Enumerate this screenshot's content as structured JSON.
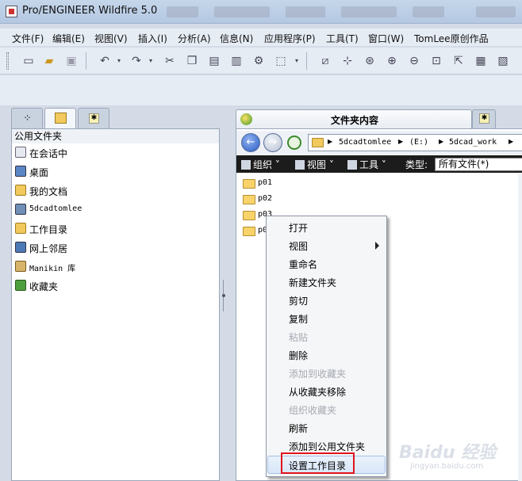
{
  "window": {
    "title": "Pro/ENGINEER Wildfire 5.0"
  },
  "menubar": [
    {
      "label": "文件(F)"
    },
    {
      "label": "编辑(E)"
    },
    {
      "label": "视图(V)"
    },
    {
      "label": "插入(I)"
    },
    {
      "label": "分析(A)"
    },
    {
      "label": "信息(N)"
    },
    {
      "label": "应用程序(P)"
    },
    {
      "label": "工具(T)"
    },
    {
      "label": "窗口(W)"
    },
    {
      "label": "TomLee原创作品"
    }
  ],
  "left_panel": {
    "header": "公用文件夹",
    "items": [
      {
        "label": "在会话中",
        "icon": "session-icon"
      },
      {
        "label": "桌面",
        "icon": "desktop-icon"
      },
      {
        "label": "我的文档",
        "icon": "documents-icon"
      },
      {
        "label": "5dcadtomlee",
        "icon": "computer-icon"
      },
      {
        "label": "工作目录",
        "icon": "working-dir-icon"
      },
      {
        "label": "网上邻居",
        "icon": "network-icon"
      },
      {
        "label": "Manikin 库",
        "icon": "library-icon"
      },
      {
        "label": "收藏夹",
        "icon": "favorites-icon"
      }
    ]
  },
  "right_panel": {
    "tab_title": "文件夹内容",
    "address": [
      "5dcadtomlee",
      "(E:)",
      "5dcad_work"
    ],
    "commands": {
      "organize": "组织",
      "view": "视图",
      "tools": "工具",
      "type_label": "类型:",
      "type_value": "所有文件(*)"
    },
    "folders": [
      "p01",
      "p02",
      "p03",
      "p04"
    ]
  },
  "context_menu": [
    {
      "label": "打开",
      "disabled": false
    },
    {
      "label": "视图",
      "disabled": false,
      "submenu": true
    },
    {
      "label": "重命名",
      "disabled": false
    },
    {
      "label": "新建文件夹",
      "disabled": false
    },
    {
      "label": "剪切",
      "disabled": false
    },
    {
      "label": "复制",
      "disabled": false
    },
    {
      "label": "粘贴",
      "disabled": true
    },
    {
      "label": "删除",
      "disabled": false
    },
    {
      "label": "添加到收藏夹",
      "disabled": true
    },
    {
      "label": "从收藏夹移除",
      "disabled": false
    },
    {
      "label": "组织收藏夹",
      "disabled": true
    },
    {
      "label": "刷新",
      "disabled": false
    },
    {
      "label": "添加到公用文件夹",
      "disabled": false
    },
    {
      "label": "设置工作目录",
      "disabled": false,
      "highlighted": true
    }
  ],
  "watermark": {
    "line1": "Baidu 经验",
    "line2": "jingyan.baidu.com"
  },
  "colors": {
    "highlight_box": "#e0141c",
    "menu_highlight": "#d8e6f8"
  }
}
